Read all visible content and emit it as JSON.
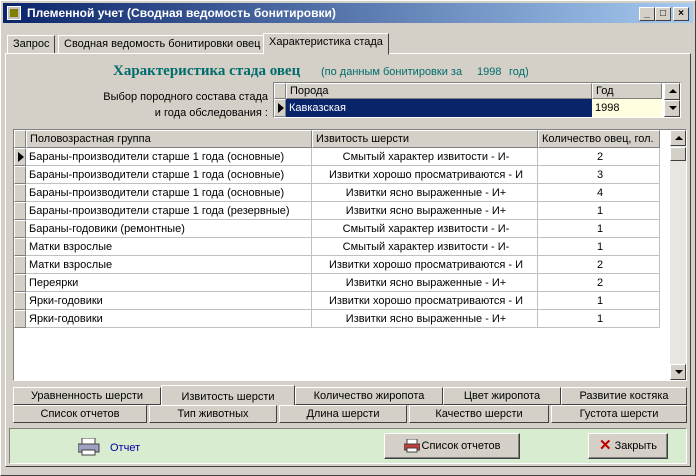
{
  "window": {
    "title": "Племенной учет (Сводная ведомость бонитировки)"
  },
  "tabs": [
    {
      "label": "Запрос"
    },
    {
      "label": "Сводная ведомость бонитировки овец"
    },
    {
      "label": "Характеристика стада"
    }
  ],
  "heading": {
    "title": "Характеристика стада овец",
    "sub": "(по данным бонитировки за",
    "year": "1998",
    "unit": "год)"
  },
  "selector": {
    "label_line1": "Выбор породного состава стада",
    "label_line2": "и года обследования :",
    "col_breed": "Порода",
    "col_year": "Год",
    "breed": "Кавказская",
    "year": "1998"
  },
  "table": {
    "columns": [
      "Половозрастная группа",
      "Извитость шерсти",
      "Количество овец, гол."
    ],
    "rows": [
      [
        "Бараны-производители старше 1 года (основные)",
        "Смытый характер извитости - И-",
        "2"
      ],
      [
        "Бараны-производители старше 1 года (основные)",
        "Извитки хорошо просматриваются - И",
        "3"
      ],
      [
        "Бараны-производители старше 1 года (основные)",
        "Извитки ясно выраженные - И+",
        "4"
      ],
      [
        "Бараны-производители старше 1 года (резервные)",
        "Извитки ясно выраженные - И+",
        "1"
      ],
      [
        "Бараны-годовики (ремонтные)",
        "Смытый характер извитости - И-",
        "1"
      ],
      [
        "Матки взрослые",
        "Смытый характер извитости - И-",
        "1"
      ],
      [
        "Матки взрослые",
        "Извитки хорошо просматриваются - И",
        "2"
      ],
      [
        "Переярки",
        "Извитки ясно выраженные - И+",
        "2"
      ],
      [
        "Ярки-годовики",
        "Извитки хорошо просматриваются - И",
        "1"
      ],
      [
        "Ярки-годовики",
        "Извитки ясно выраженные - И+",
        "1"
      ]
    ]
  },
  "bottom_tabs_row1": [
    "Уравненность шерсти",
    "Извитость шерсти",
    "Количество жиропота",
    "Цвет жиропота",
    "Развитие костяка"
  ],
  "bottom_tabs_row2": [
    "Список отчетов",
    "Тип животных",
    "Длина шерсти",
    "Качество шерсти",
    "Густота шерсти"
  ],
  "footer": {
    "report_link": "Отчет",
    "reports_button": "Список отчетов",
    "close_button": "Закрыть"
  },
  "colors": {
    "titlebar": "#0a246a",
    "heading": "#006c6c",
    "selection": "#0a246a",
    "footer": "#d8ecd0"
  }
}
